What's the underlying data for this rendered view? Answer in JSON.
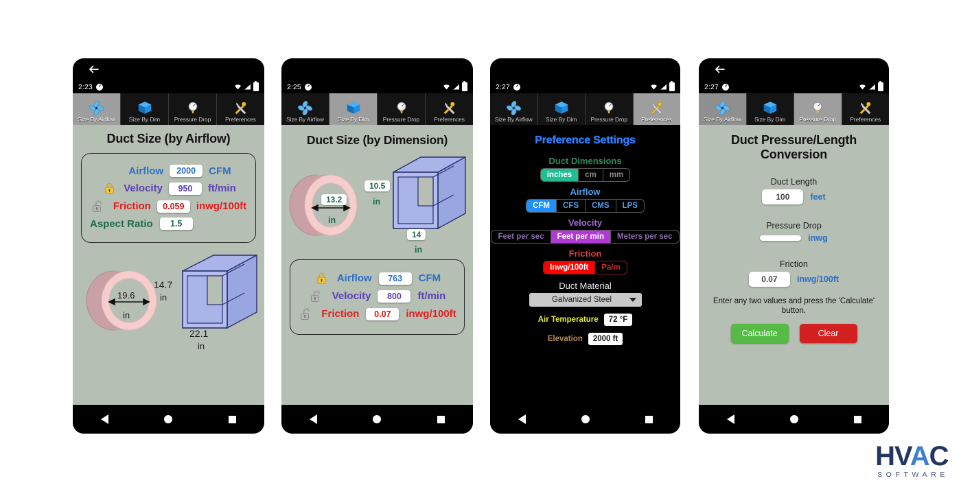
{
  "meta": {
    "brand": {
      "name_part1": "HV",
      "name_part2": "A",
      "name_part3": "C",
      "tagline": "SOFTWARE"
    },
    "colors": {
      "screen_bg": "#b6bfb4",
      "dark_bg": "#000000",
      "airflow": "#2d6fc4",
      "velocity": "#5b3fb3",
      "friction": "#e02020",
      "aspect": "#1d6b48",
      "tab_selected": "#9e9e9e",
      "calculate": "#55bb44",
      "clear": "#d32020",
      "teal_selected": "#1fbf93",
      "blue_selected": "#1e90ff",
      "purple_selected": "#b13ad6",
      "red_selected": "#ff0000",
      "title_dark": "#2f7fff"
    }
  },
  "tabs": [
    {
      "label": "Size By Airflow",
      "icon": "fan-icon"
    },
    {
      "label": "Size By Dim",
      "icon": "cube-icon"
    },
    {
      "label": "Pressure Drop",
      "icon": "gauge-icon"
    },
    {
      "label": "Preferences",
      "icon": "tools-icon"
    }
  ],
  "nav": {
    "back": "nav-back-icon",
    "home": "nav-home-icon",
    "recent": "nav-recent-icon"
  },
  "phone1": {
    "back_arrow": "back-arrow-icon",
    "status": {
      "time": "2:23",
      "wifi": "wifi-icon",
      "signal": "signal-icon",
      "battery": "battery-icon"
    },
    "active_tab": 0,
    "title": "Duct Size (by Airflow)",
    "rows": [
      {
        "lock": "none",
        "label": "Airflow",
        "value": "2000",
        "unit": "CFM"
      },
      {
        "lock": "locked",
        "label": "Velocity",
        "value": "950",
        "unit": "ft/min"
      },
      {
        "lock": "unlocked",
        "label": "Friction",
        "value": "0.059",
        "unit": "inwg/100ft"
      },
      {
        "lock": "none",
        "label": "Aspect Ratio",
        "value": "1.5",
        "unit": ""
      }
    ],
    "diagram": {
      "round_diameter": "19.6",
      "round_unit": "in",
      "rect_height": "14.7",
      "rect_height_unit": "in",
      "rect_width": "22.1",
      "rect_width_unit": "in"
    }
  },
  "phone2": {
    "status": {
      "time": "2:25",
      "wifi": "wifi-icon",
      "signal": "signal-icon",
      "battery": "battery-icon"
    },
    "active_tab": 1,
    "title": "Duct Size (by Dimension)",
    "diagram": {
      "round_diameter": "13.2",
      "round_unit": "in",
      "rect_height": "10.5",
      "rect_height_unit": "in",
      "rect_width": "14",
      "rect_width_unit": "in"
    },
    "rows": [
      {
        "lock": "locked",
        "label": "Airflow",
        "value": "763",
        "unit": "CFM"
      },
      {
        "lock": "unlocked",
        "label": "Velocity",
        "value": "800",
        "unit": "ft/min"
      },
      {
        "lock": "unlocked",
        "label": "Friction",
        "value": "0.07",
        "unit": "inwg/100ft"
      }
    ]
  },
  "phone3": {
    "status": {
      "time": "2:27",
      "wifi": "wifi-icon",
      "signal": "signal-icon",
      "battery": "battery-icon"
    },
    "active_tab": 3,
    "title": "Preference Settings",
    "groups": [
      {
        "heading": "Duct Dimensions",
        "color": "#2e8b57",
        "options": [
          "inches",
          "cm",
          "mm"
        ],
        "selected": 0,
        "sel_bg": "#1fbf93",
        "sel_fg": "#ffffff"
      },
      {
        "heading": "Airflow",
        "color": "#4f9fe8",
        "options": [
          "CFM",
          "CFS",
          "CMS",
          "LPS"
        ],
        "selected": 0,
        "sel_bg": "#1e90ff",
        "sel_fg": "#ffffff"
      },
      {
        "heading": "Velocity",
        "color": "#a46ad6",
        "options": [
          "Feet per sec",
          "Feet per min",
          "Meters per sec"
        ],
        "selected": 1,
        "sel_bg": "#b13ad6",
        "sel_fg": "#ffffff"
      },
      {
        "heading": "Friction",
        "color": "#e04040",
        "options": [
          "Inwg/100ft",
          "Pa/m"
        ],
        "selected": 0,
        "sel_bg": "#ff0000",
        "sel_fg": "#ffffff"
      }
    ],
    "material": {
      "heading": "Duct Material",
      "value": "Galvanized Steel",
      "caret": "chevron-down-icon"
    },
    "air_temperature": {
      "label": "Air Temperature",
      "value": "72 °F",
      "color": "#e8e83c"
    },
    "elevation": {
      "label": "Elevation",
      "value": "2000 ft",
      "color": "#b8895a"
    }
  },
  "phone4": {
    "back_arrow": "back-arrow-icon",
    "status": {
      "time": "2:27",
      "wifi": "wifi-icon",
      "signal": "signal-icon",
      "battery": "battery-icon"
    },
    "active_tab": 2,
    "title_line1": "Duct Pressure/Length",
    "title_line2": "Conversion",
    "fields": [
      {
        "label": "Duct Length",
        "value": "100",
        "unit": "feet"
      },
      {
        "label": "Pressure Drop",
        "value": "",
        "unit": "inwg"
      },
      {
        "label": "Friction",
        "value": "0.07",
        "unit": "inwg/100ft"
      }
    ],
    "hint": "Enter any two values and press the 'Calculate' button.",
    "buttons": {
      "calculate": "Calculate",
      "clear": "Clear"
    }
  }
}
